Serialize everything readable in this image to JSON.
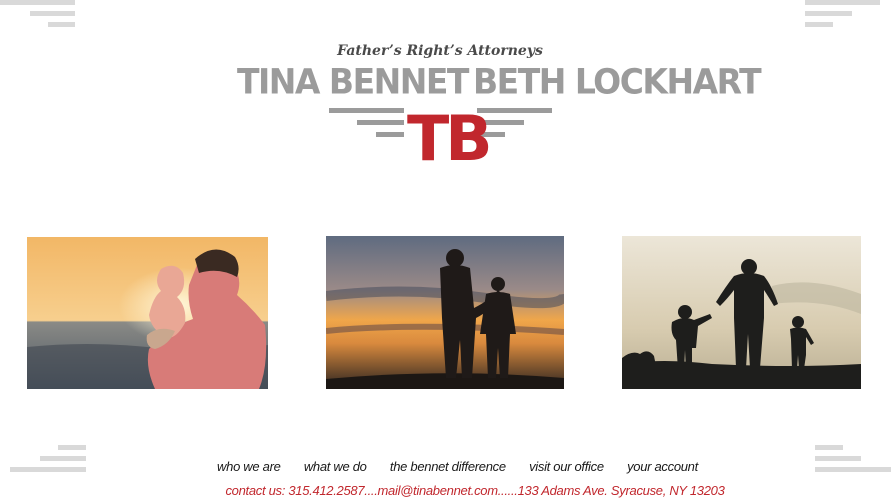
{
  "header": {
    "tagline": "Father’s Right’s Attorneys",
    "attorney_left": "TINA BENNET",
    "attorney_right": "BETH LOCKHART",
    "monogram": "TB"
  },
  "photos": [
    {
      "name": "father-child-beach-sunset"
    },
    {
      "name": "father-son-silhouette-sunset"
    },
    {
      "name": "father-children-silhouette-hill"
    }
  ],
  "nav": {
    "items": [
      "who we are",
      "what we do",
      "the bennet difference",
      "visit our office",
      "your account"
    ]
  },
  "contact": {
    "line": "contact us: 315.412.2587....mail@tinabennet.com......133 Adams Ave. Syracuse, NY 13203"
  },
  "colors": {
    "accent_red": "#c1272d",
    "title_gray": "#9b9b9b",
    "decor_gray": "#d9d9d9"
  }
}
